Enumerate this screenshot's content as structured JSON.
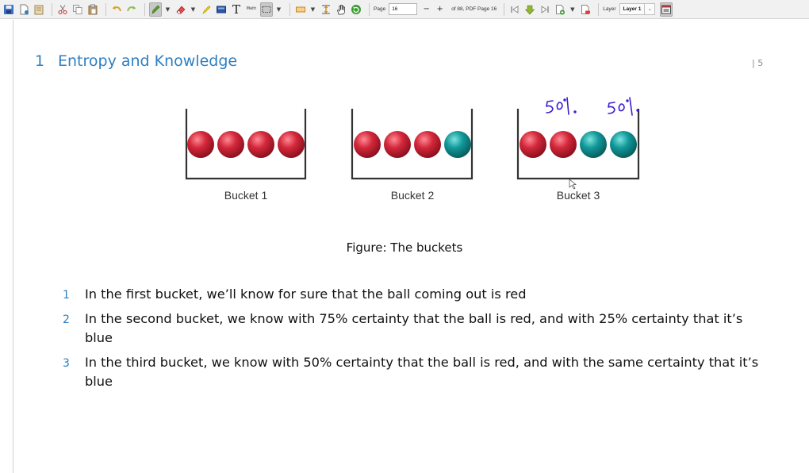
{
  "toolbar": {
    "page_label": "Page",
    "page_value": "16",
    "page_minus": "−",
    "page_plus": "+",
    "page_of": "of 88, PDF Page 16",
    "math_icon_text": "Math",
    "layer_label": "Layer",
    "layer_value": "Layer 1"
  },
  "document": {
    "section_number": "1",
    "section_title": "Entropy and Knowledge",
    "page_number": "| 5",
    "figure": {
      "buckets": [
        {
          "label": "Bucket 1",
          "balls": [
            "red",
            "red",
            "red",
            "red"
          ]
        },
        {
          "label": "Bucket 2",
          "balls": [
            "red",
            "red",
            "red",
            "teal"
          ]
        },
        {
          "label": "Bucket 3",
          "balls": [
            "red",
            "red",
            "teal",
            "teal"
          ]
        }
      ],
      "caption": "Figure: The buckets",
      "annotations": [
        {
          "text": "50%",
          "color": "#3b1fd1"
        },
        {
          "text": "50%",
          "color": "#3b1fd1"
        }
      ]
    },
    "list": [
      {
        "number": "1",
        "text": "In the first bucket, we’ll know for sure that the ball coming out is red"
      },
      {
        "number": "2",
        "text": "In the second bucket, we know with 75% certainty that the ball is red, and with 25% certainty that it’s blue"
      },
      {
        "number": "3",
        "text": "In the third bucket, we know with 50% certainty that the ball is red, and with the same certainty that it’s blue"
      }
    ]
  },
  "colors": {
    "accent": "#2f7fc1",
    "ball_red": "#d3283b",
    "ball_teal": "#12999a",
    "ink": "#3b1fd1"
  }
}
